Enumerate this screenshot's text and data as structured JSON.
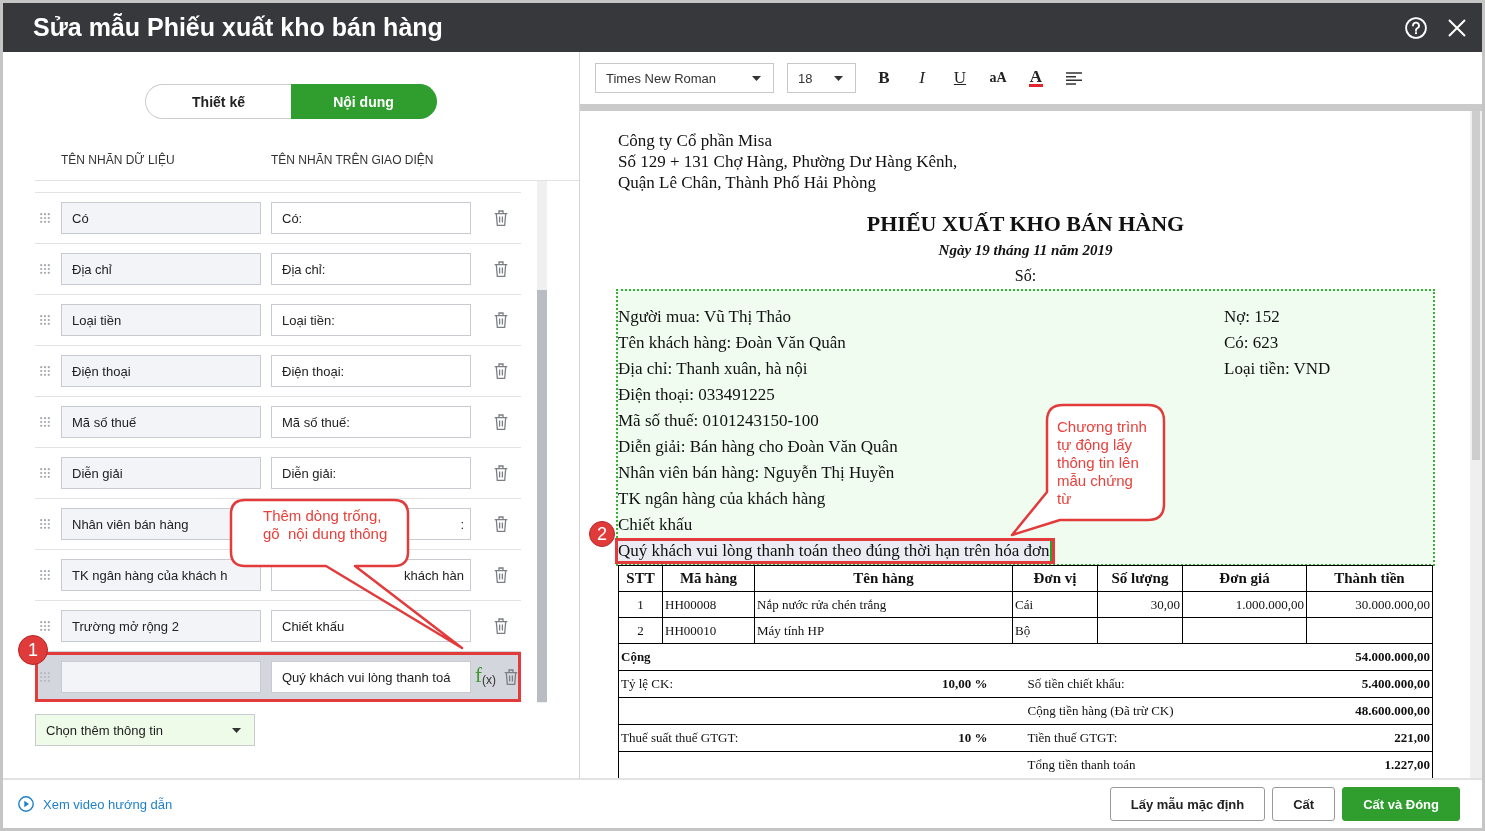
{
  "window": {
    "title": "Sửa mẫu Phiếu xuất kho bán hàng"
  },
  "mode_tabs": [
    {
      "label": "Thiết kế",
      "selected": false
    },
    {
      "label": "Nội dung",
      "selected": true
    }
  ],
  "field_list": {
    "columns": [
      "TÊN NHÃN DỮ LIỆU",
      "TÊN NHÃN TRÊN GIAO DIỆN"
    ],
    "rows": [
      {
        "data_label": "Có",
        "display_label": "Có:",
        "display_cut_start": false,
        "highlighted": false
      },
      {
        "data_label": "Địa chỉ",
        "display_label": "Địa chỉ:",
        "display_cut_start": false,
        "highlighted": false
      },
      {
        "data_label": "Loại tiền",
        "display_label": "Loại tiền:",
        "display_cut_start": false,
        "highlighted": false
      },
      {
        "data_label": "Điện thoại",
        "display_label": "Điện thoại:",
        "display_cut_start": false,
        "highlighted": false
      },
      {
        "data_label": "Mã số thuế",
        "display_label": "Mã số thuế:",
        "display_cut_start": false,
        "highlighted": false
      },
      {
        "data_label": "Diễn giải",
        "display_label": "Diễn giải:",
        "display_cut_start": false,
        "highlighted": false
      },
      {
        "data_label": "Nhân viên bán hàng",
        "display_label": ":",
        "display_cut_start": true,
        "highlighted": false
      },
      {
        "data_label": "TK ngân hàng của khách h",
        "display_label": "khách hàn",
        "display_cut_start": true,
        "highlighted": false
      },
      {
        "data_label": "Trường mở rộng 2",
        "display_label": "Chiết khấu",
        "display_cut_start": false,
        "highlighted": false
      },
      {
        "display_label": "Quý khách vui lòng thanh toá",
        "formula_label": "f$_{(x)}$",
        "display_cut_start": false,
        "highlighted": true
      }
    ],
    "add_select": "Chọn thêm thông tin"
  },
  "toolbar": {
    "font_family": "Times New Roman",
    "font_size": "18",
    "tools": [
      {
        "kind": "bold",
        "glyph": "B"
      },
      {
        "kind": "italic",
        "glyph": "I"
      },
      {
        "kind": "underline",
        "glyph": "U"
      },
      {
        "kind": "case",
        "glyph": "aA"
      },
      {
        "kind": "color",
        "glyph": "A"
      },
      {
        "kind": "align"
      }
    ]
  },
  "document": {
    "company_lines": [
      "Công ty Cổ phần Misa",
      "Số 129 + 131 Chợ Hàng, Phường Dư Hàng Kênh,",
      "Quận Lê Chân, Thành Phố Hải Phòng"
    ],
    "title": "PHIẾU XUẤT KHO BÁN HÀNG",
    "date": "Ngày 19 tháng 11 năm 2019",
    "number_label": "Số:",
    "info_left": [
      {
        "text": "Người mua: Vũ Thị Thảo",
        "highlighted": false
      },
      {
        "text": "Tên khách hàng: Đoàn Văn Quân",
        "highlighted": false
      },
      {
        "text": "Địa chỉ: Thanh xuân, hà nội",
        "highlighted": false
      },
      {
        "text": "Điện thoại: 033491225",
        "highlighted": false
      },
      {
        "text": "Mã số thuế: 0101243150-100",
        "highlighted": false
      },
      {
        "text": "Diễn giải: Bán hàng cho Đoàn Văn Quân",
        "highlighted": false
      },
      {
        "text": "Nhân viên bán hàng: Nguyễn Thị Huyền",
        "highlighted": false
      },
      {
        "text": "TK ngân hàng của khách hàng",
        "highlighted": false
      },
      {
        "text": "Chiết khấu",
        "highlighted": false
      },
      {
        "text": "Quý khách vui lòng thanh toán theo đúng thời hạn trên hóa đơn",
        "highlighted": true
      }
    ],
    "info_right": [
      "Nợ: 152",
      "Có: 623",
      "Loại tiền: VND"
    ],
    "items_table": {
      "columns": [
        "STT",
        "Mã hàng",
        "Tên hàng",
        "Đơn vị",
        "Số lượng",
        "Đơn giá",
        "Thành tiền"
      ],
      "rows": [
        {
          "stt": "1",
          "code": "HH00008",
          "name": "Nắp nước rửa chén trắng",
          "unit": "Cái",
          "quantity": "30,00",
          "unit_price": "1.000.000,00",
          "amount": "30.000.000,00"
        },
        {
          "stt": "2",
          "code": "HH00010",
          "name": "Máy tính HP",
          "unit": "Bộ"
        }
      ],
      "totals": [
        {
          "kind": "total",
          "label": "Cộng",
          "amount": "54.000.000,00"
        },
        {
          "kind": "pair",
          "left_label": "Tỷ lệ CK:",
          "left_value": "10,00 %",
          "right_label": "Số tiền chiết khấu:",
          "amount": "5.400.000,00"
        },
        {
          "kind": "pair",
          "right_label": "Cộng tiền hàng (Đã trừ CK)",
          "amount": "48.600.000,00"
        },
        {
          "kind": "pair",
          "left_label": "Thuế suất thuế GTGT:",
          "left_value": "10 %",
          "right_label": "Tiền thuế GTGT:",
          "amount": "221,00"
        },
        {
          "kind": "pair",
          "right_label": "Tổng tiền thanh toán",
          "amount": "1.227,00"
        }
      ]
    }
  },
  "footer": {
    "help_link": "Xem video hướng dẫn",
    "buttons": [
      {
        "label": "Lấy mẫu mặc định",
        "kind": "secondary"
      },
      {
        "label": "Cất",
        "kind": "secondary"
      },
      {
        "label": "Cất và Đóng",
        "kind": "primary"
      }
    ]
  },
  "annotations": [
    {
      "badge": "1",
      "callout_lines": [
        "Thêm dòng trống,",
        "gõ  nội dung thông"
      ]
    },
    {
      "badge": "2",
      "callout_lines": [
        "Chương trình",
        "tự động lấy",
        "thông tin lên",
        "mẫu chứng",
        "từ"
      ]
    }
  ]
}
